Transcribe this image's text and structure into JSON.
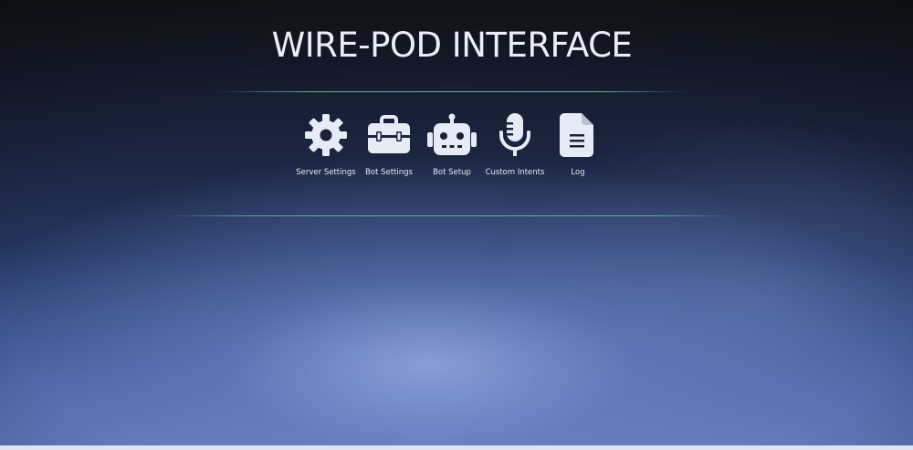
{
  "header": {
    "title": "WIRE-POD INTERFACE"
  },
  "nav": {
    "items": [
      {
        "label": "Server Settings",
        "icon": "gear-icon"
      },
      {
        "label": "Bot Settings",
        "icon": "toolbox-icon"
      },
      {
        "label": "Bot Setup",
        "icon": "robot-icon"
      },
      {
        "label": "Custom Intents",
        "icon": "microphone-icon"
      },
      {
        "label": "Log",
        "icon": "document-icon"
      }
    ]
  },
  "colors": {
    "accent_line": "#5ad2af",
    "icon_fill": "#e6ecf6",
    "background_top": "#12151b",
    "background_bottom": "#5f78bb"
  }
}
